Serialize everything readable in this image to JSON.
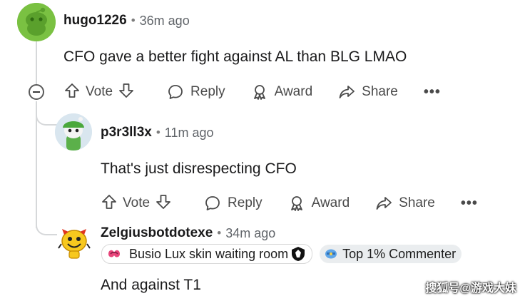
{
  "comments": [
    {
      "username": "hugo1226",
      "time": "36m ago",
      "body": "CFO gave a better fight against AL than BLG LMAO",
      "actions": {
        "vote": "Vote",
        "reply": "Reply",
        "award": "Award",
        "share": "Share"
      }
    },
    {
      "username": "p3r3ll3x",
      "time": "11m ago",
      "body": "That's just disrespecting CFO",
      "actions": {
        "vote": "Vote",
        "reply": "Reply",
        "award": "Award",
        "share": "Share"
      }
    },
    {
      "username": "Zelgiusbotdotexe",
      "time": "34m ago",
      "flairs": [
        "Busio Lux skin waiting room",
        "Top 1% Commenter"
      ],
      "body": "And against T1"
    }
  ],
  "separator": "•",
  "more_label": "•••",
  "watermark": "搜狐号@游戏大妹",
  "colors": {
    "avatar_green": "#7ac142",
    "thread_line": "#d6d8da"
  }
}
